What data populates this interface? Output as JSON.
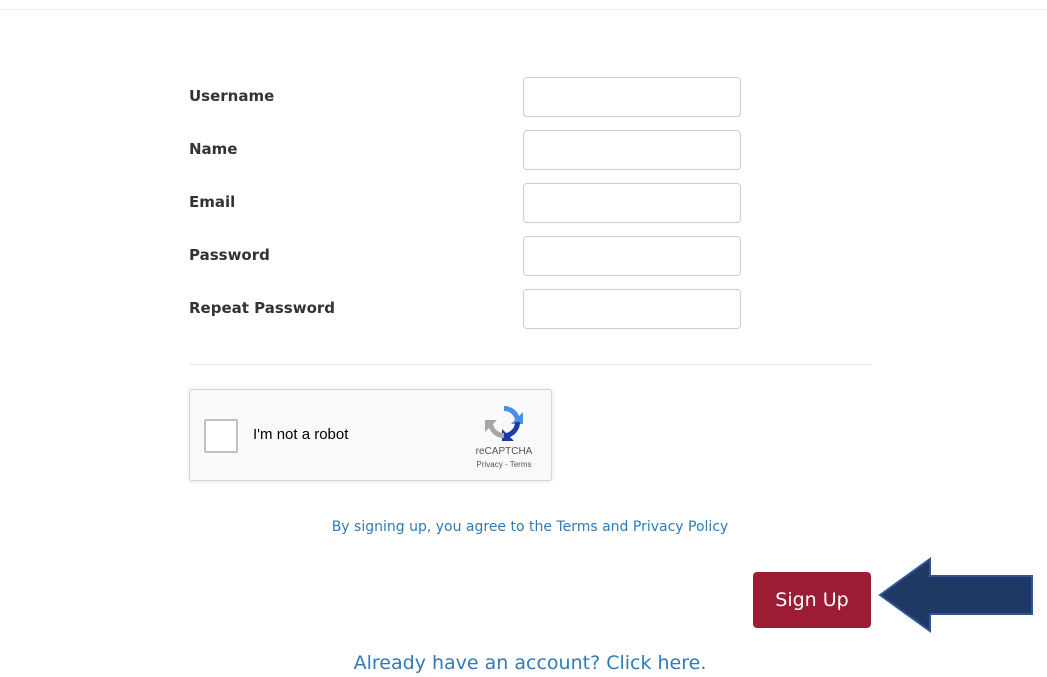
{
  "form": {
    "fields": [
      {
        "label": "Username",
        "value": "",
        "placeholder": ""
      },
      {
        "label": "Name",
        "value": "",
        "placeholder": ""
      },
      {
        "label": "Email",
        "value": "",
        "placeholder": ""
      },
      {
        "label": "Password",
        "value": "",
        "placeholder": ""
      },
      {
        "label": "Repeat Password",
        "value": "",
        "placeholder": ""
      }
    ]
  },
  "recaptcha": {
    "label": "I'm not a robot",
    "brand": "reCAPTCHA",
    "links": "Privacy - Terms",
    "checked": false,
    "icon": "recaptcha-logo-icon"
  },
  "terms": {
    "text": "By signing up, you agree to the Terms and Privacy Policy"
  },
  "signup": {
    "label": "Sign Up"
  },
  "login": {
    "text": "Already have an account? Click here."
  },
  "annotation": {
    "icon": "arrow-left-icon"
  },
  "colors": {
    "accent": "#9b1c33",
    "link": "#2f7ab8",
    "arrow_fill": "#1f3864",
    "arrow_stroke": "#2f5597"
  }
}
